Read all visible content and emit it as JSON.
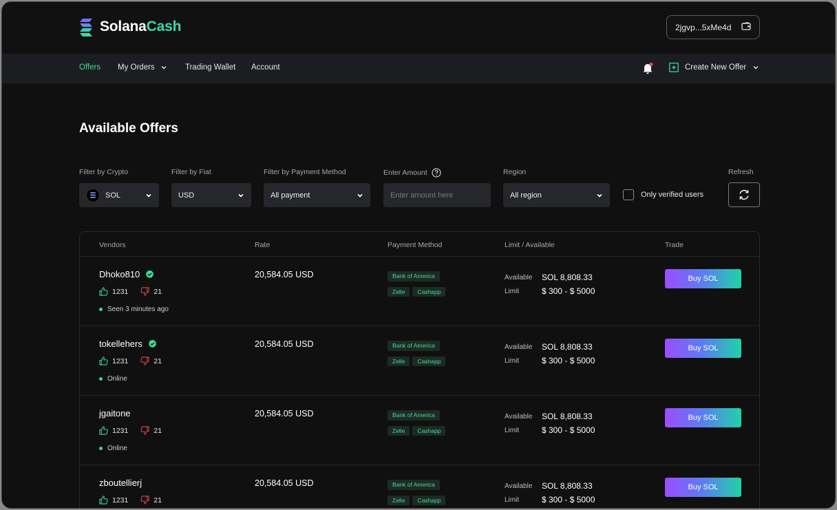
{
  "brand": {
    "name_part1": "Solana",
    "name_part2": "Cash"
  },
  "wallet": {
    "address": "2jgvp...5xMe4d",
    "icon": "wallet-icon"
  },
  "nav": {
    "items": [
      {
        "label": "Offers",
        "active": true
      },
      {
        "label": "My Orders",
        "has_dropdown": true
      },
      {
        "label": "Trading Wallet"
      },
      {
        "label": "Account"
      }
    ],
    "create_offer": "Create New Offer"
  },
  "page": {
    "title": "Available Offers"
  },
  "filters": {
    "crypto": {
      "label": "Filter by Crypto",
      "value": "SOL"
    },
    "fiat": {
      "label": "Filter by Fiat",
      "value": "USD"
    },
    "payment": {
      "label": "Filter by Payment Method",
      "value": "All payment"
    },
    "amount": {
      "label": "Enter Amount",
      "placeholder": "Enter amount here"
    },
    "region": {
      "label": "Region",
      "value": "All region"
    },
    "verified": {
      "label": "Only verified users",
      "checked": false
    },
    "refresh": {
      "label": "Refresh"
    }
  },
  "table": {
    "headers": [
      "Vendors",
      "Rate",
      "Payment Method",
      "Limit / Available",
      "Trade"
    ],
    "rows": [
      {
        "vendor": "Dhoko810",
        "verified": true,
        "likes": "1231",
        "dislikes": "21",
        "status": "Seen 3 minutes ago",
        "rate": "20,584.05 USD",
        "methods": [
          "Bank of America",
          "Zelle",
          "Cashapp"
        ],
        "available_label": "Available",
        "available": "SOL 8,808.33",
        "limit_label": "Limit",
        "limit": "$ 300 - $ 5000",
        "action": "Buy SOL"
      },
      {
        "vendor": "tokellehers",
        "verified": true,
        "likes": "1231",
        "dislikes": "21",
        "status": "Online",
        "rate": "20,584.05 USD",
        "methods": [
          "Bank of America",
          "Zelle",
          "Cashapp"
        ],
        "available_label": "Available",
        "available": "SOL 8,808.33",
        "limit_label": "Limit",
        "limit": "$ 300 - $ 5000",
        "action": "Buy SOL"
      },
      {
        "vendor": "jgaitone",
        "verified": false,
        "likes": "1231",
        "dislikes": "21",
        "status": "Online",
        "rate": "20,584.05 USD",
        "methods": [
          "Bank of America",
          "Zelle",
          "Cashapp"
        ],
        "available_label": "Available",
        "available": "SOL 8,808.33",
        "limit_label": "Limit",
        "limit": "$ 300 - $ 5000",
        "action": "Buy SOL"
      },
      {
        "vendor": "zboutellierj",
        "verified": false,
        "likes": "1231",
        "dislikes": "21",
        "status": "",
        "rate": "20,584.05 USD",
        "methods": [
          "Bank of America",
          "Zelle",
          "Cashapp"
        ],
        "available_label": "Available",
        "available": "SOL 8,808.33",
        "limit_label": "Limit",
        "limit": "$ 300 - $ 5000",
        "action": "Buy SOL"
      }
    ]
  },
  "colors": {
    "accent": "#3ddc97",
    "dislike": "#e5484d",
    "background": "#101010",
    "navbar": "#1c1d20"
  }
}
